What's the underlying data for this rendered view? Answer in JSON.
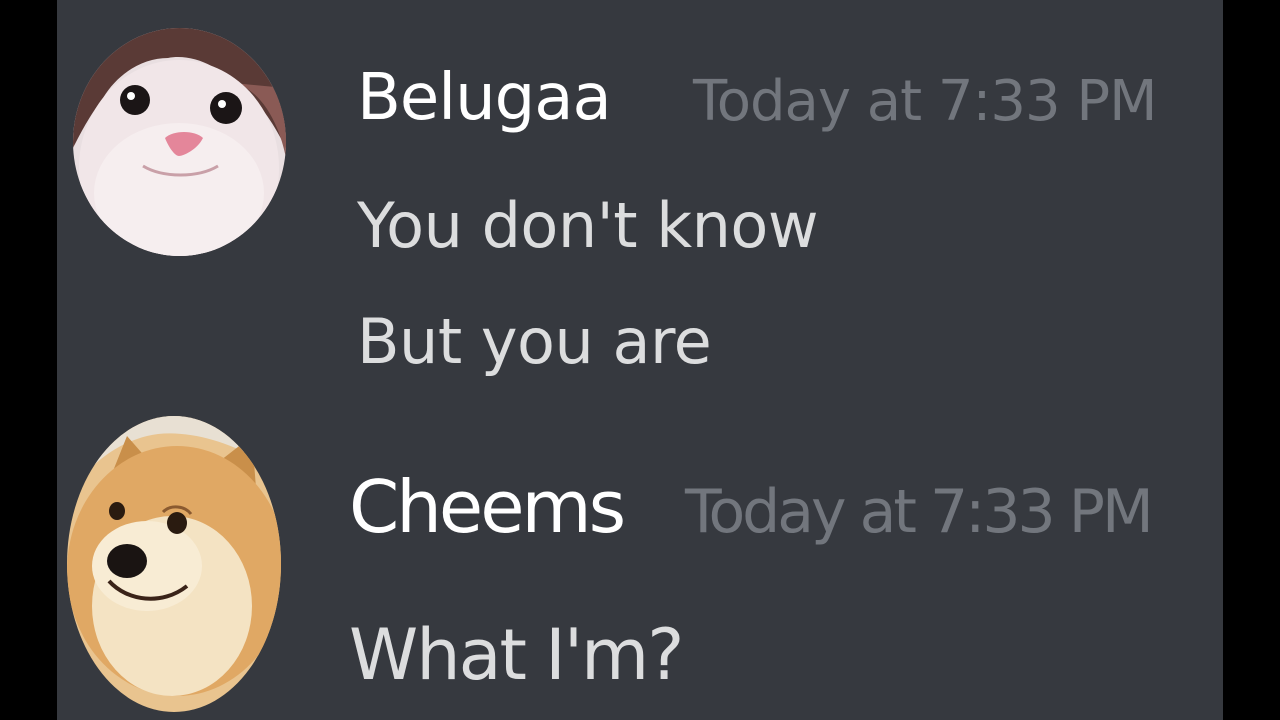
{
  "colors": {
    "background": "#36393f",
    "side_bars": "#000000",
    "username": "#ffffff",
    "timestamp": "#72767d",
    "message_text": "#dcddde"
  },
  "messages": [
    {
      "author": "Belugaa",
      "timestamp": "Today at 7:33 PM",
      "avatar_icon": "cat-avatar-icon",
      "lines": [
        "You don't know",
        "But you are"
      ]
    },
    {
      "author": "Cheems",
      "timestamp": "Today at 7:33 PM",
      "avatar_icon": "doge-avatar-icon",
      "lines": [
        "What I'm?"
      ]
    }
  ]
}
